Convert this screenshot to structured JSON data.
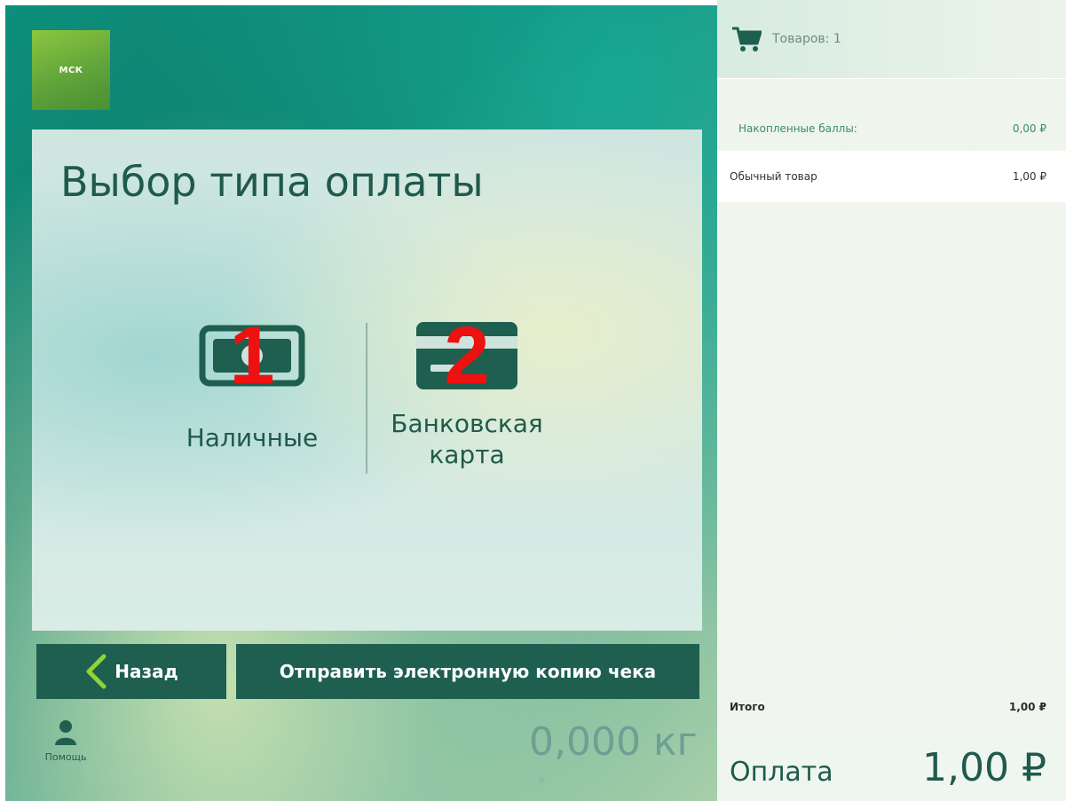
{
  "logo": {
    "text": "МСК"
  },
  "main": {
    "title": "Выбор типа оплаты",
    "options": [
      {
        "label": "Наличные",
        "marker": "1",
        "icon": "cash-icon"
      },
      {
        "label_line1": "Банковская",
        "label_line2": "карта",
        "marker": "2",
        "icon": "bank-card-icon"
      }
    ]
  },
  "buttons": {
    "back_label": "Назад",
    "send_label": "Отправить электронную копию чека"
  },
  "footer": {
    "help_label": "Помощь",
    "weight": "0,000 кг"
  },
  "cart": {
    "count_label": "Товаров: 1",
    "points_label": "Накопленные баллы:",
    "points_value": "0,00 ₽",
    "items": [
      {
        "name": "Обычный товар",
        "price": "1,00 ₽"
      }
    ],
    "total_label": "Итого",
    "total_value": "1,00 ₽",
    "pay_label": "Оплата",
    "pay_value": "1,00 ₽"
  },
  "colors": {
    "primary": "#1f5f50",
    "marker": "#ee1111",
    "logo": "#6aae3b"
  }
}
